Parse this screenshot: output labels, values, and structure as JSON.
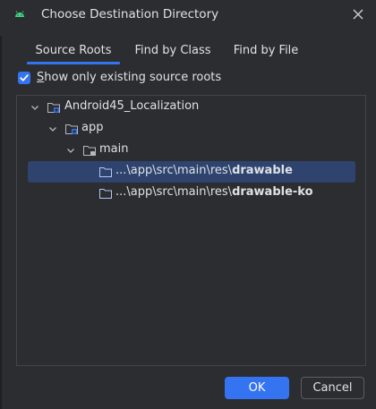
{
  "window": {
    "title": "Choose Destination Directory",
    "icon": "android-icon",
    "close_icon": "close-icon"
  },
  "tabs": [
    {
      "label": "Source Roots",
      "active": true
    },
    {
      "label": "Find by Class",
      "active": false
    },
    {
      "label": "Find by File",
      "active": false
    }
  ],
  "filter": {
    "checkbox_checked": true,
    "label_prefix": "S",
    "label_rest": "how only existing source roots"
  },
  "tree": {
    "nodes": [
      {
        "label": "Android45_Localization",
        "icon": "module-folder-icon",
        "expanded": true,
        "level": 0
      },
      {
        "label": "app",
        "icon": "module-folder-icon",
        "expanded": true,
        "level": 1
      },
      {
        "label": "main",
        "icon": "source-folder-icon",
        "expanded": true,
        "level": 2
      },
      {
        "label_prefix": "...\\app\\src\\main\\res\\",
        "label_bold": "drawable",
        "icon": "folder-icon",
        "selected": true,
        "level": 3
      },
      {
        "label_prefix": "...\\app\\src\\main\\res\\",
        "label_bold": "drawable-ko",
        "icon": "folder-icon",
        "selected": false,
        "level": 3
      }
    ]
  },
  "buttons": {
    "ok": "OK",
    "cancel": "Cancel"
  },
  "colors": {
    "background": "#2b2d30",
    "accent": "#3574f0",
    "selection": "#2e436e",
    "border": "#43454a",
    "text": "#dfe1e5"
  }
}
